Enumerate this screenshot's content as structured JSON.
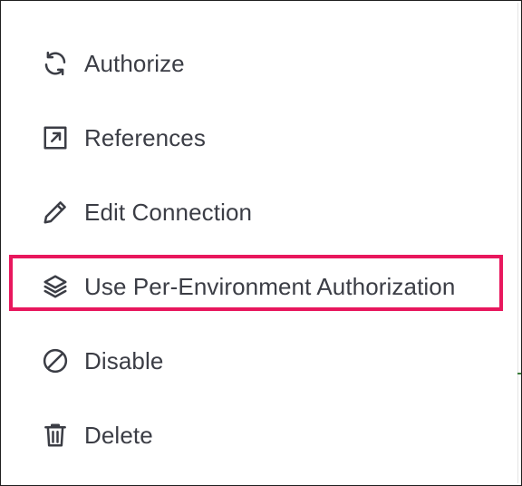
{
  "menu": {
    "items": [
      {
        "label": "Authorize",
        "icon": "refresh-icon"
      },
      {
        "label": "References",
        "icon": "external-link-icon"
      },
      {
        "label": "Edit Connection",
        "icon": "pencil-icon"
      },
      {
        "label": "Use Per-Environment Authorization",
        "icon": "layers-icon",
        "highlighted": true
      },
      {
        "label": "Disable",
        "icon": "disable-icon"
      },
      {
        "label": "Delete",
        "icon": "trash-icon"
      }
    ]
  },
  "colors": {
    "text": "#3b3d45",
    "highlight_border": "#e8175d",
    "background": "#ffffff"
  }
}
